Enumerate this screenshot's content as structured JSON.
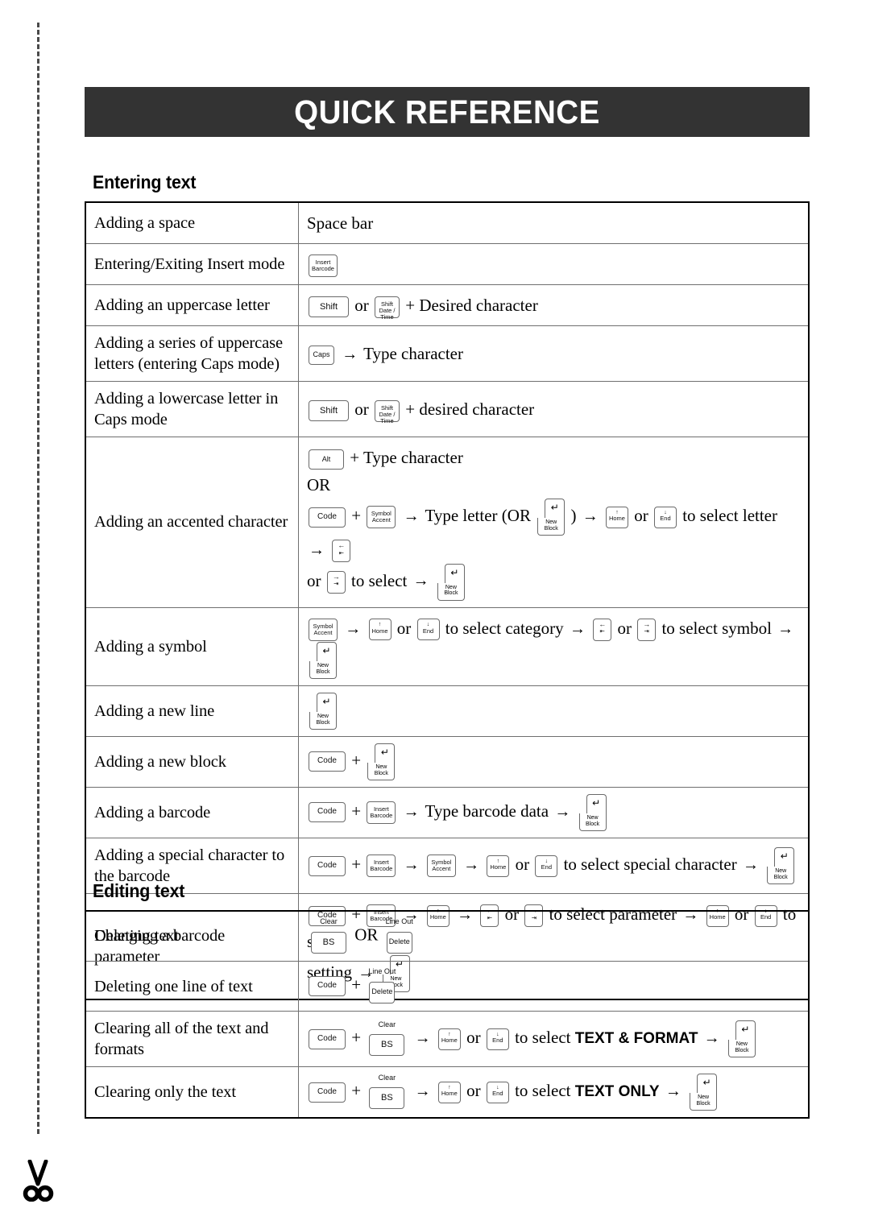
{
  "header": {
    "title": "QUICK REFERENCE"
  },
  "cut_line": {
    "scissors_icon": "scissors-icon"
  },
  "keys": {
    "insert_barcode": {
      "l1": "Insert",
      "l2": "Barcode"
    },
    "shift": {
      "l1": "Shift"
    },
    "shift_date_time": {
      "l1": "Shift",
      "l2": "Date /",
      "l3": "Time"
    },
    "caps": {
      "l1": "Caps"
    },
    "alt": {
      "l1": "Alt"
    },
    "code": {
      "l1": "Code"
    },
    "symbol_accent": {
      "l1": "Symbol",
      "l2": "Accent"
    },
    "home": {
      "glyph": "↑",
      "l1": "Home"
    },
    "end": {
      "glyph": "↓",
      "l1": "End"
    },
    "left": {
      "glyph": "←",
      "l2": "⇤"
    },
    "right": {
      "glyph": "→",
      "l2": "⇥"
    },
    "new_block": {
      "glyph": "↵",
      "l1": "New",
      "l2": "Block"
    },
    "bs": {
      "above": "Clear",
      "l1": "BS"
    },
    "delete": {
      "above": "Line Out",
      "l1": "Delete"
    }
  },
  "sections": [
    {
      "id": "entering",
      "heading": "Entering text",
      "rows": [
        {
          "label": "Adding a space",
          "action_text": "Space bar"
        },
        {
          "label": "Entering/Exiting Insert mode",
          "action_text": ""
        },
        {
          "label": "Adding an uppercase letter",
          "or_label": "or",
          "plus_text": "+ Desired character"
        },
        {
          "label": "Adding a series of uppercase letters (entering Caps mode)",
          "arrow_text": "Type character"
        },
        {
          "label": "Adding a lowercase letter in Caps mode",
          "or_label": "or",
          "plus_text": "+ desired character"
        },
        {
          "label": "Adding an accented character",
          "line1_text": "+ Type character",
          "or_text": "OR",
          "plus_sign": "+",
          "type_letter": "Type letter (OR",
          "close_paren": ")",
          "or_label": "or",
          "select_letter": "to select letter",
          "or_label2": "or",
          "to_select": "to select"
        },
        {
          "label": "Adding a symbol",
          "or_label": "or",
          "select_category": "to select category",
          "or_label2": "or",
          "select_symbol": "to select symbol"
        },
        {
          "label": "Adding a new line",
          "action_text": ""
        },
        {
          "label": "Adding a new block",
          "plus_sign": "+"
        },
        {
          "label": "Adding a barcode",
          "plus_sign": "+",
          "type_data": "Type barcode data"
        },
        {
          "label": "Adding a special character to the barcode",
          "plus_sign": "+",
          "or_label": "or",
          "select_special": "to select special character"
        },
        {
          "label": "Changing a barcode parameter",
          "plus_sign": "+",
          "or_label": "or",
          "select_parameter": "to select parameter",
          "or_label2": "or",
          "to_select": "to select",
          "setting": "setting"
        }
      ]
    },
    {
      "id": "editing",
      "heading": "Editing text",
      "rows": [
        {
          "label": "Deleting text",
          "or_text": "OR"
        },
        {
          "label": "Deleting one line of text",
          "plus_sign": "+"
        },
        {
          "label": "Clearing all of the text and formats",
          "plus_sign": "+",
          "or_label": "or",
          "select_text": "to select",
          "emphasis": "TEXT & FORMAT"
        },
        {
          "label": "Clearing only the text",
          "plus_sign": "+",
          "or_label": "or",
          "select_text": "to select",
          "emphasis": "TEXT ONLY"
        }
      ]
    }
  ],
  "glyphs": {
    "arrow_right": "→",
    "plus": "+"
  }
}
